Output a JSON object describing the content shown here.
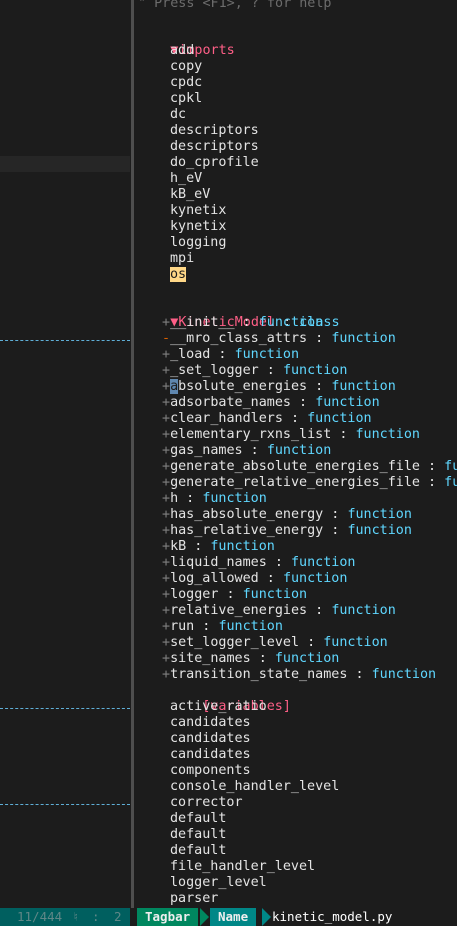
{
  "help_text": "\" Press <F1>, ? for help",
  "imports": {
    "title": "imports",
    "items": [
      "add",
      "copy",
      "cpdc",
      "cpkl",
      "dc",
      "descriptors",
      "descriptors",
      "do_cprofile",
      "h_eV",
      "kB_eV",
      "kynetix",
      "kynetix",
      "logging",
      "mpi",
      "os"
    ]
  },
  "class_section": {
    "name": "KineticModel",
    "sep": " : ",
    "kind": "class",
    "functions": [
      {
        "sign": "+",
        "name": "__init__",
        "type": "function"
      },
      {
        "sign": "-",
        "name": "__mro_class_attrs",
        "type": "function"
      },
      {
        "sign": "+",
        "name": "_load",
        "type": "function"
      },
      {
        "sign": "+",
        "name": "_set_logger",
        "type": "function"
      },
      {
        "sign": "+",
        "name": "absolute_energies",
        "type": "function"
      },
      {
        "sign": "+",
        "name": "adsorbate_names",
        "type": "function"
      },
      {
        "sign": "+",
        "name": "clear_handlers",
        "type": "function"
      },
      {
        "sign": "+",
        "name": "elementary_rxns_list",
        "type": "function"
      },
      {
        "sign": "+",
        "name": "gas_names",
        "type": "function"
      },
      {
        "sign": "+",
        "name": "generate_absolute_energies_file",
        "type": "fu"
      },
      {
        "sign": "+",
        "name": "generate_relative_energies_file",
        "type": "fu"
      },
      {
        "sign": "+",
        "name": "h",
        "type": "function"
      },
      {
        "sign": "+",
        "name": "has_absolute_energy",
        "type": "function"
      },
      {
        "sign": "+",
        "name": "has_relative_energy",
        "type": "function"
      },
      {
        "sign": "+",
        "name": "kB",
        "type": "function"
      },
      {
        "sign": "+",
        "name": "liquid_names",
        "type": "function"
      },
      {
        "sign": "+",
        "name": "log_allowed",
        "type": "function"
      },
      {
        "sign": "+",
        "name": "logger",
        "type": "function"
      },
      {
        "sign": "+",
        "name": "relative_energies",
        "type": "function"
      },
      {
        "sign": "+",
        "name": "run",
        "type": "function"
      },
      {
        "sign": "+",
        "name": "set_logger_level",
        "type": "function"
      },
      {
        "sign": "+",
        "name": "site_names",
        "type": "function"
      },
      {
        "sign": "+",
        "name": "transition_state_names",
        "type": "function"
      }
    ],
    "variables_label": "[variables]",
    "variables": [
      "active_ratio",
      "candidates",
      "candidates",
      "candidates",
      "components",
      "console_handler_level",
      "corrector",
      "default",
      "default",
      "default",
      "file_handler_level",
      "logger_level",
      "parser"
    ]
  },
  "statusbar": {
    "position": "11/444",
    "line_icon": "♮",
    "colon": ":",
    "column": "2",
    "plugin": "Tagbar",
    "sort": "Name",
    "file": "kinetic_model.py"
  },
  "colors": {
    "background": "#1c1c1c",
    "keyword": "#ff5f87",
    "function_type": "#5fd7ff",
    "cursor_highlight": "#ffd787",
    "status_green": "#00875f",
    "status_teal": "#008787"
  }
}
